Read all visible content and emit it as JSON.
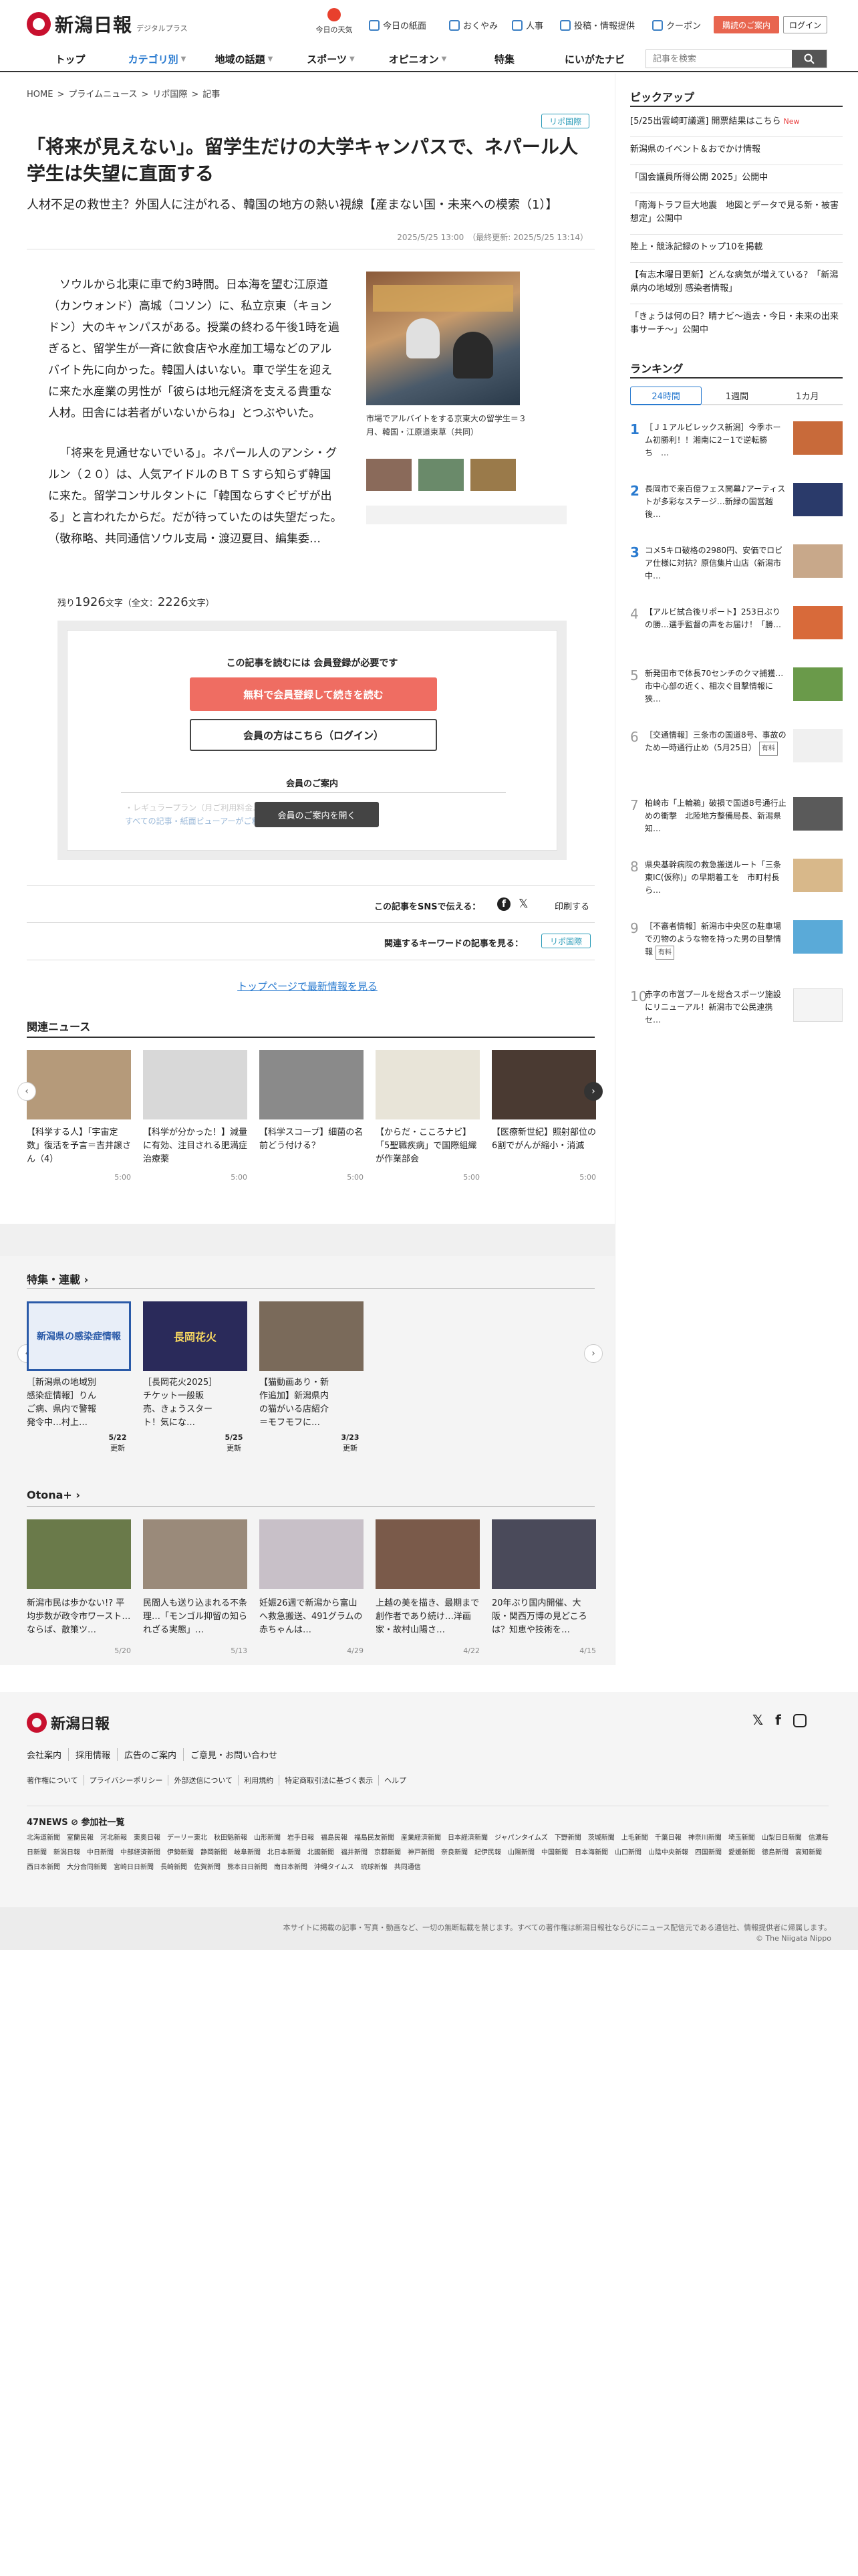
{
  "header": {
    "logo_text": "新潟日報",
    "logo_sub": "デジタルプラス",
    "weather_label": "今日の天気",
    "utils": [
      "今日の紙面",
      "おくやみ",
      "人事",
      "投稿・情報提供",
      "クーポン"
    ],
    "store_button": "購読のご案内",
    "login_button": "ログイン",
    "nav": [
      "トップ",
      "カテゴリ別",
      "地域の話題",
      "スポーツ",
      "オピニオン",
      "特集",
      "にいがたナビ"
    ],
    "search_placeholder": "記事を検索"
  },
  "article": {
    "breadcrumb": [
      "HOME",
      ">",
      "プライムニュース",
      ">",
      "リポ国際",
      ">",
      "記事"
    ],
    "tag": "リポ国際",
    "title": "「将来が見えない」。留学生だけの大学キャンパスで、ネパール人学生は失望に直面する",
    "subtitle": "人材不足の救世主？外国人に注がれる、韓国の地方の熱い視線【産まない国・未来への模索（1）】",
    "date": "2025/5/25 13:00　（最終更新: 2025/5/25 13:14）",
    "paragraphs": [
      "ソウルから北東に車で約3時間。日本海を望む江原道（カンウォンド）高城（コソン）に、私立京東（キョンドン）大のキャンパスがある。授業の終わる午後1時を過ぎると、留学生が一斉に飲食店や水産加工場などのアルバイト先に向かった。韓国人はいない。車で学生を迎えに来た水産業の男性が「彼らは地元経済を支える貴重な人材。田舎には若者がいないからね」とつぶやいた。",
      "「将来を見通せないでいる」。ネパール人のアンシ・グルン（２０）は、人気アイドルのＢＴＳすら知らず韓国に来た。留学コンサルタントに「韓国ならすぐビザが出る」と言われたからだ。だが待っていたのは失望だった。（敬称略、共同通信ソウル支局・渡辺夏目、編集委…"
    ],
    "photo_caption": "市場でアルバイトをする京東大の留学生＝３月、韓国・江原道束草（共同）",
    "remaining_prefix": "残り",
    "remaining_chars": "1926",
    "remaining_mid": "文字（全文：",
    "total_chars": "2226",
    "remaining_suffix": "文字）"
  },
  "paywall": {
    "title": "この記事を読むには 会員登録が必要です",
    "free_button": "無料で会員登録して続きを読む",
    "login_button": "会員の方はこちら（ログイン）",
    "guide_title": "会員のご案内",
    "blur_line1": "・レギュラープラン（月ご利用料金…",
    "blur_line2": "すべての記事・紙面ビューアーがご利用…",
    "guide_button": "会員のご案内を開く"
  },
  "share": {
    "label": "この記事をSNSで伝える：",
    "print": "印刷する",
    "kw_label": "関連するキーワードの記事を見る：",
    "kw_tag": "リポ国際",
    "top_link": "トップページで最新情報を見る"
  },
  "related": {
    "title": "関連ニュース",
    "items": [
      {
        "caption": "【科学する人】「宇宙定数」復活を予言＝吉井譲さん（4）",
        "time": "5:00",
        "color": "#b59a7a"
      },
      {
        "caption": "【科学が分かった！】減量に有効、注目される肥満症治療薬",
        "time": "5:00",
        "color": "#d8d8d8"
      },
      {
        "caption": "【科学スコープ】細菌の名前どう付ける？",
        "time": "5:00",
        "color": "#8a8a8a"
      },
      {
        "caption": "【からだ・こころナビ】「5聖職疾病」で国際組織が作業部会",
        "time": "5:00",
        "color": "#e8e4d8"
      },
      {
        "caption": "【医療新世紀】照射部位の6割でがんが縮小・消滅",
        "time": "5:00",
        "color": "#4a3a32"
      }
    ]
  },
  "series": {
    "title": "特集・連載",
    "items": [
      {
        "caption": "［新潟県の地域別感染症情報］りんご病、県内で警報発令中…村上…",
        "date": "5/22",
        "badge": "更新",
        "color": "#e8eef8",
        "img_text": "新潟県の感染症情報"
      },
      {
        "caption": "［長岡花火2025］チケット一般販売、きょうスタート！気にな…",
        "date": "5/25",
        "badge": "更新",
        "color": "#2a2a5a",
        "img_text": "長岡花火"
      },
      {
        "caption": "【猫動画あり・新作追加】新潟県内の猫がいる店紹介＝モフモフに…",
        "date": "3/23",
        "badge": "更新",
        "color": "#7a6a5a",
        "img_text": ""
      }
    ]
  },
  "otona": {
    "title": "Otona+",
    "items": [
      {
        "caption": "新潟市民は歩かない!? 平均歩数が政令市ワースト…ならば、散策ツ…",
        "date": "5/20",
        "color": "#6a7a4a"
      },
      {
        "caption": "民間人も送り込まれる不条理…「モンゴル抑留の知られざる実態」…",
        "date": "5/13",
        "color": "#9a8a7a"
      },
      {
        "caption": "妊娠26週で新潟から富山へ救急搬送、491グラムの赤ちゃんは…",
        "date": "4/29",
        "color": "#c8c0c8"
      },
      {
        "caption": "上越の美を描き、最期まで創作者であり続け…洋画家・故村山陽さ…",
        "date": "4/22",
        "color": "#7a5a4a"
      },
      {
        "caption": "20年ぶり国内開催、大阪・関西万博の見どころは？知恵や技術を…",
        "date": "4/15",
        "color": "#4a4a5a"
      }
    ]
  },
  "sidebar": {
    "pickup_title": "ピックアップ",
    "pickup": [
      {
        "text": "[5/25出雲崎町議選] 開票結果はこちら",
        "new": "New"
      },
      {
        "text": "新潟県のイベント＆おでかけ情報",
        "new": ""
      },
      {
        "text": "「国会議員所得公開 2025」公開中",
        "new": ""
      },
      {
        "text": "「南海トラフ巨大地震　地図とデータで見る新・被害想定」公開中",
        "new": ""
      },
      {
        "text": "陸上・競泳記録のトップ10を掲載",
        "new": ""
      },
      {
        "text": "【有志木曜日更新】どんな病気が増えている？「新潟県内の地域別 感染者情報」",
        "new": ""
      },
      {
        "text": "「きょうは何の日？晴ナビ～過去・今日・未来の出来事サーチ～」公開中",
        "new": ""
      }
    ],
    "ranking_title": "ランキング",
    "tabs": [
      "24時間",
      "1週間",
      "1カ月"
    ],
    "ranking": [
      {
        "rank": "1",
        "text": "［Ｊ１アルビレックス新潟］今季ホーム初勝利！！湘南に2－1で逆転勝ち　…",
        "paid": "",
        "color": "#c86a3a"
      },
      {
        "rank": "2",
        "text": "長岡市で来百億フェス開幕♪アーティストが多彩なステージ…新緑の国営越後…",
        "paid": "",
        "color": "#2a3a6a"
      },
      {
        "rank": "3",
        "text": "コメ5キロ破格の2980円、安価でロビア仕様に対抗？原信集片山店（新潟市中…",
        "paid": "",
        "color": "#c8a88a"
      },
      {
        "rank": "4",
        "text": "【アルビ試合後リポート】253日ぶりの勝…選手監督の声をお届け！「勝…",
        "paid": "",
        "color": "#d86a3a"
      },
      {
        "rank": "5",
        "text": "新発田市で体長70センチのクマ捕獲…市中心部の近く、相次ぐ目撃情報に狭…",
        "paid": "",
        "color": "#6a9a4a"
      },
      {
        "rank": "6",
        "text": "［交通情報］三条市の国道8号、事故のため一時通行止め（5月25日）",
        "paid": "有料",
        "color": "#f0f0f0"
      },
      {
        "rank": "7",
        "text": "柏崎市「上輪鵜」破損で国道8号通行止めの衝撃　北陸地方整備局長、新潟県知…",
        "paid": "",
        "color": "#5a5a5a"
      },
      {
        "rank": "8",
        "text": "県央基幹病院の救急搬送ルート「三条東IC(仮称)」の早期着工を　市町村長ら…",
        "paid": "",
        "color": "#d8b88a"
      },
      {
        "rank": "9",
        "text": "［不審者情報］新潟市中央区の駐車場で刃物のような物を持った男の目撃情報",
        "paid": "有料",
        "color": "#5aaad8"
      },
      {
        "rank": "10",
        "text": "赤字の市営プールを総合スポーツ施設にリニューアル！新潟市で公民連携セ…",
        "paid": "",
        "color": "#f4f4f4"
      }
    ]
  },
  "footer": {
    "logo_text": "新潟日報",
    "links1": [
      "会社案内",
      "採用情報",
      "広告のご案内",
      "ご意見・お問い合わせ"
    ],
    "links2": [
      "著作権について",
      "プライバシーポリシー",
      "外部送信について",
      "利用規約",
      "特定商取引法に基づく表示",
      "ヘルプ"
    ],
    "net47_title": "47NEWS ⊘ 参加社一覧",
    "papers": [
      "北海道新聞",
      "室蘭民報",
      "河北新報",
      "東奥日報",
      "デーリー東北",
      "秋田魁新報",
      "山形新聞",
      "岩手日報",
      "福島民報",
      "福島民友新聞",
      "産業経済新聞",
      "日本経済新聞",
      "ジャパンタイムズ",
      "下野新聞",
      "茨城新聞",
      "上毛新聞",
      "千葉日報",
      "神奈川新聞",
      "埼玉新聞",
      "山梨日日新聞",
      "信濃毎日新聞",
      "新潟日報",
      "中日新聞",
      "中部経済新聞",
      "伊勢新聞",
      "静岡新聞",
      "岐阜新聞",
      "北日本新聞",
      "北國新聞",
      "福井新聞",
      "京都新聞",
      "神戸新聞",
      "奈良新聞",
      "紀伊民報",
      "山陽新聞",
      "中国新聞",
      "日本海新聞",
      "山口新聞",
      "山陰中央新報",
      "四国新聞",
      "愛媛新聞",
      "徳島新聞",
      "高知新聞",
      "西日本新聞",
      "大分合同新聞",
      "宮崎日日新聞",
      "長崎新聞",
      "佐賀新聞",
      "熊本日日新聞",
      "南日本新聞",
      "沖縄タイムス",
      "琉球新報",
      "共同通信"
    ],
    "copy1": "本サイトに掲載の記事・写真・動画など、一切の無断転載を禁じます。すべての著作権は新潟日報社ならびにニュース配信元である通信社、情報提供者に帰属します。",
    "copy2": "© The Niigata Nippo"
  },
  "colors": {
    "accent": "#2a7bd0",
    "cta": "#ef6d62",
    "brand": "#c8102e"
  }
}
